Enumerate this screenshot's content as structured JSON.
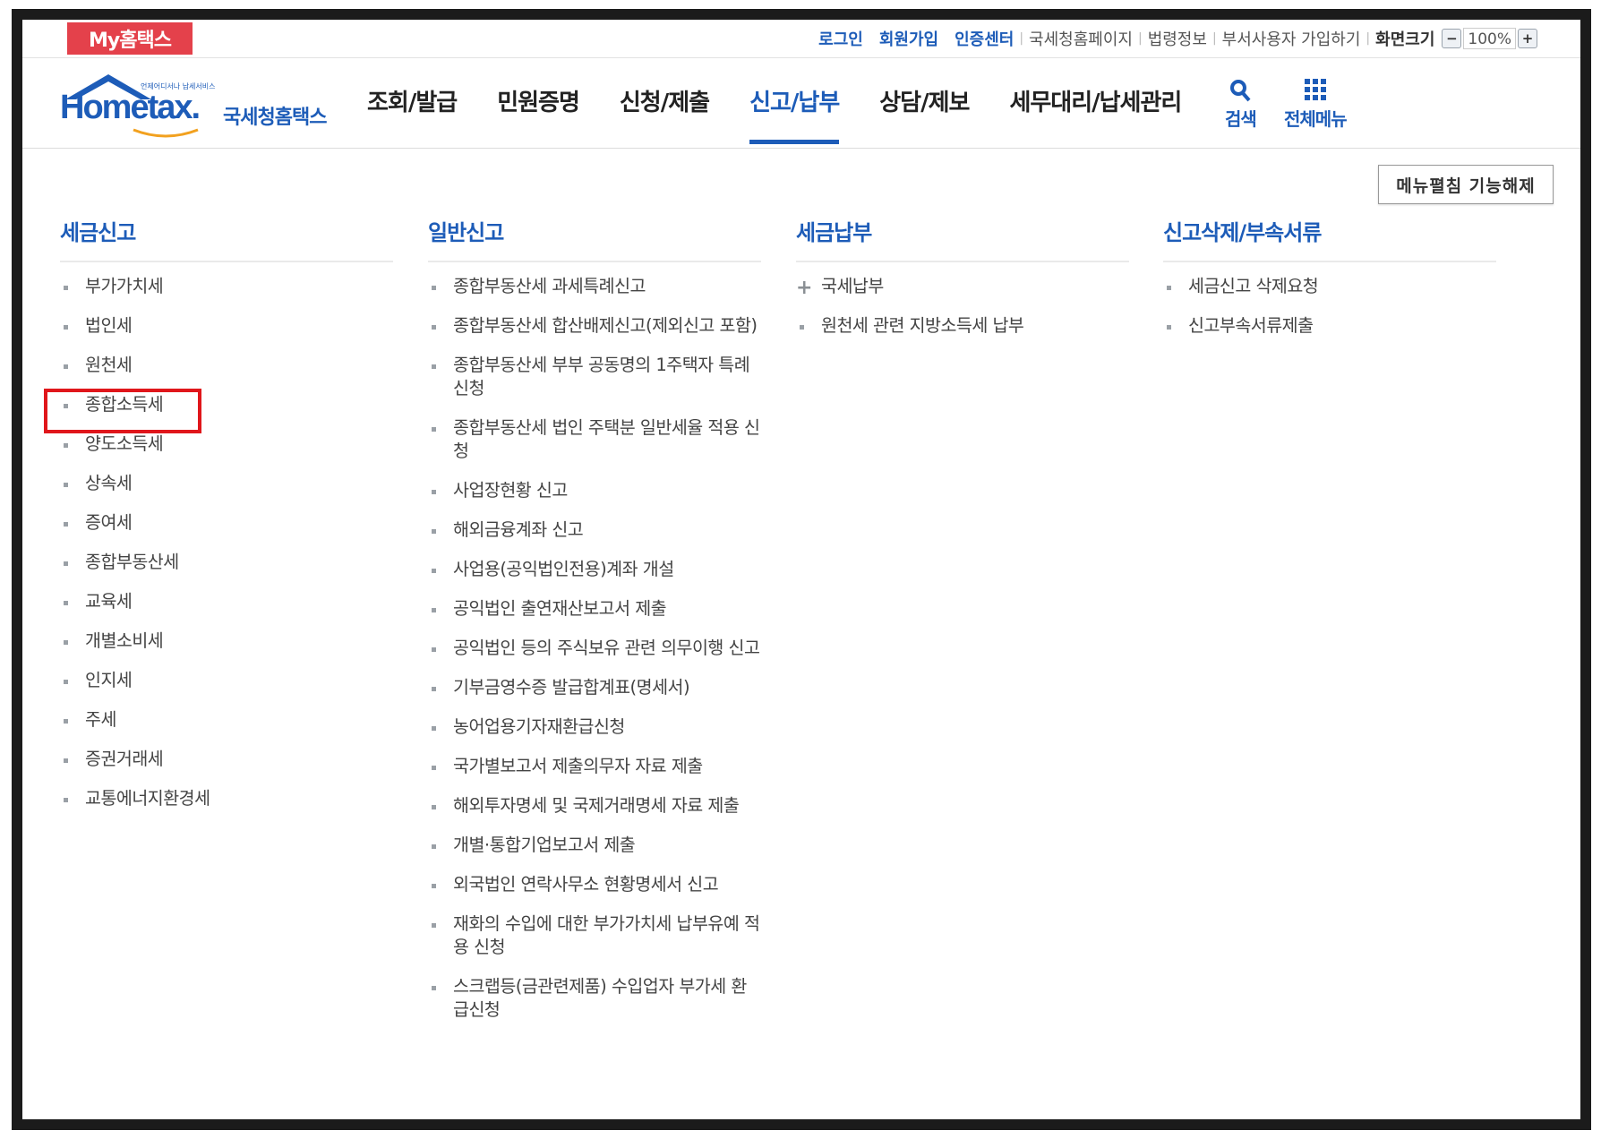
{
  "topbar": {
    "brand": "My홈택스",
    "links_blue": [
      "로그인",
      "회원가입",
      "인증센터"
    ],
    "links_gray": [
      "국세청홈페이지",
      "법령정보",
      "부서사용자 가입하기"
    ],
    "screen_size_label": "화면크기",
    "zoom_minus": "−",
    "zoom_value": "100%",
    "zoom_plus": "+"
  },
  "header": {
    "logo_text": "Hometax.",
    "logo_sub": "국세청홈택스",
    "logo_tag": "언제어디서나 납세서비스",
    "nav": [
      "조회/발급",
      "민원증명",
      "신청/제출",
      "신고/납부",
      "상담/제보",
      "세무대리/납세관리"
    ],
    "active_nav": "신고/납부",
    "search_label": "검색",
    "all_menu_label": "전체메뉴"
  },
  "fold_button_label": "메뉴펼침 기능해제",
  "columns": [
    {
      "title": "세금신고",
      "items": [
        "부가가치세",
        "법인세",
        "원천세",
        "종합소득세",
        "양도소득세",
        "상속세",
        "증여세",
        "종합부동산세",
        "교육세",
        "개별소비세",
        "인지세",
        "주세",
        "증권거래세",
        "교통에너지환경세"
      ]
    },
    {
      "title": "일반신고",
      "items": [
        "종합부동산세 과세특례신고",
        "종합부동산세 합산배제신고(제외신고 포함)",
        "종합부동산세 부부 공동명의 1주택자 특례 신청",
        "종합부동산세 법인 주택분 일반세율 적용 신청",
        "사업장현황 신고",
        "해외금융계좌 신고",
        "사업용(공익법인전용)계좌 개설",
        "공익법인 출연재산보고서 제출",
        "공익법인 등의 주식보유 관련 의무이행 신고",
        "기부금영수증 발급합계표(명세서)",
        "농어업용기자재환급신청",
        "국가별보고서 제출의무자 자료 제출",
        "해외투자명세 및 국제거래명세 자료 제출",
        "개별·통합기업보고서 제출",
        "외국법인 연락사무소 현황명세서 신고",
        "재화의 수입에 대한 부가가치세 납부유예 적용 신청",
        "스크랩등(금관련제품) 수입업자 부가세 환급신청"
      ]
    },
    {
      "title": "세금납부",
      "items": [
        "국세납부",
        "원천세 관련 지방소득세 납부"
      ]
    },
    {
      "title": "신고삭제/부속서류",
      "items": [
        "세금신고 삭제요청",
        "신고부속서류제출"
      ]
    }
  ],
  "highlighted_item": "종합소득세",
  "colors": {
    "brand_blue": "#1d5cb8",
    "brand_red": "#e4414b",
    "highlight": "#e0161b"
  },
  "icons": {
    "search": "search-icon",
    "all_menu": "grid-icon",
    "expand": "plus-icon"
  }
}
